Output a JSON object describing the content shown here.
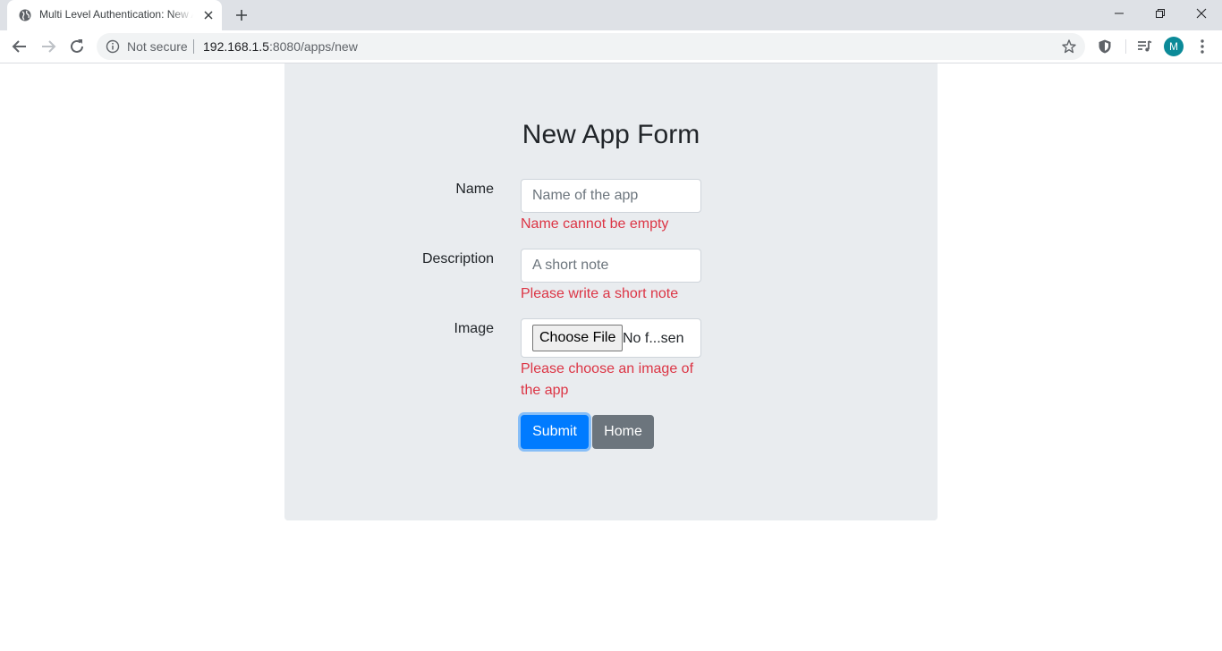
{
  "browser": {
    "tab_title": "Multi Level Authentication: New App",
    "security_label": "Not secure",
    "url_host": "192.168.1.5",
    "url_path": ":8080/apps/new",
    "profile_initial": "M"
  },
  "form": {
    "title": "New App Form",
    "name": {
      "label": "Name",
      "placeholder": "Name of the app",
      "value": "",
      "error": "Name cannot be empty"
    },
    "description": {
      "label": "Description",
      "placeholder": "A short note",
      "value": "",
      "error": "Please write a short note"
    },
    "image": {
      "label": "Image",
      "button": "Choose File",
      "status": "No f...sen",
      "error": "Please choose an image of the app"
    },
    "submit_label": "Submit",
    "home_label": "Home"
  },
  "colors": {
    "primary": "#007bff",
    "secondary": "#6c757d",
    "danger": "#dc3545",
    "panel": "#e9ecef",
    "avatar": "#0b8a98"
  }
}
